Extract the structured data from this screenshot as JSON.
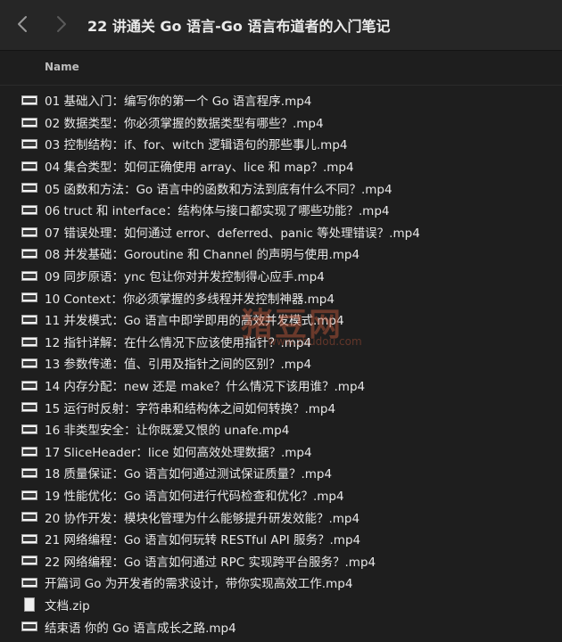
{
  "window": {
    "title": "22 讲通关 Go 语言-Go 语言布道者的入门笔记",
    "icons": {
      "back": "chevron-left-icon",
      "forward": "chevron-right-icon"
    }
  },
  "table": {
    "column_name": "Name"
  },
  "files": [
    {
      "name": "01  基础入门：编写你的第一个 Go 语言程序.mp4",
      "kind": "video"
    },
    {
      "name": "02  数据类型：你必须掌握的数据类型有哪些？.mp4",
      "kind": "video"
    },
    {
      "name": "03  控制结构：if、for、witch 逻辑语句的那些事儿.mp4",
      "kind": "video"
    },
    {
      "name": "04  集合类型：如何正确使用 array、lice 和 map？.mp4",
      "kind": "video"
    },
    {
      "name": "05  函数和方法：Go 语言中的函数和方法到底有什么不同？.mp4",
      "kind": "video"
    },
    {
      "name": "06  truct 和 interface：结构体与接口都实现了哪些功能？.mp4",
      "kind": "video"
    },
    {
      "name": "07  错误处理：如何通过 error、deferred、panic 等处理错误？.mp4",
      "kind": "video"
    },
    {
      "name": "08  并发基础：Goroutine 和 Channel 的声明与使用.mp4",
      "kind": "video"
    },
    {
      "name": "09  同步原语：ync 包让你对并发控制得心应手.mp4",
      "kind": "video"
    },
    {
      "name": "10  Context：你必须掌握的多线程并发控制神器.mp4",
      "kind": "video"
    },
    {
      "name": "11  并发模式：Go 语言中即学即用的高效并发模式.mp4",
      "kind": "video"
    },
    {
      "name": "12  指针详解：在什么情况下应该使用指针？.mp4",
      "kind": "video"
    },
    {
      "name": "13  参数传递：值、引用及指针之间的区别？.mp4",
      "kind": "video"
    },
    {
      "name": "14  内存分配：new 还是 make？什么情况下该用谁？.mp4",
      "kind": "video"
    },
    {
      "name": "15  运行时反射：字符串和结构体之间如何转换？.mp4",
      "kind": "video"
    },
    {
      "name": "16  非类型安全：让你既爱又恨的 unafe.mp4",
      "kind": "video"
    },
    {
      "name": "17  SliceHeader：lice 如何高效处理数据？.mp4",
      "kind": "video"
    },
    {
      "name": "18  质量保证：Go 语言如何通过测试保证质量？.mp4",
      "kind": "video"
    },
    {
      "name": "19  性能优化：Go 语言如何进行代码检查和优化？.mp4",
      "kind": "video"
    },
    {
      "name": "20  协作开发：模块化管理为什么能够提升研发效能？.mp4",
      "kind": "video"
    },
    {
      "name": "21  网络编程：Go 语言如何玩转 RESTful API 服务？.mp4",
      "kind": "video"
    },
    {
      "name": "22  网络编程：Go 语言如何通过 RPC 实现跨平台服务？.mp4",
      "kind": "video"
    },
    {
      "name": "开篇词  Go 为开发者的需求设计，带你实现高效工作.mp4",
      "kind": "video"
    },
    {
      "name": "文档.zip",
      "kind": "doc"
    },
    {
      "name": "结束语  你的 Go 语言成长之路.mp4",
      "kind": "video"
    }
  ],
  "watermark": {
    "text": "猪豆网",
    "sub": "www.zhudou.com"
  }
}
